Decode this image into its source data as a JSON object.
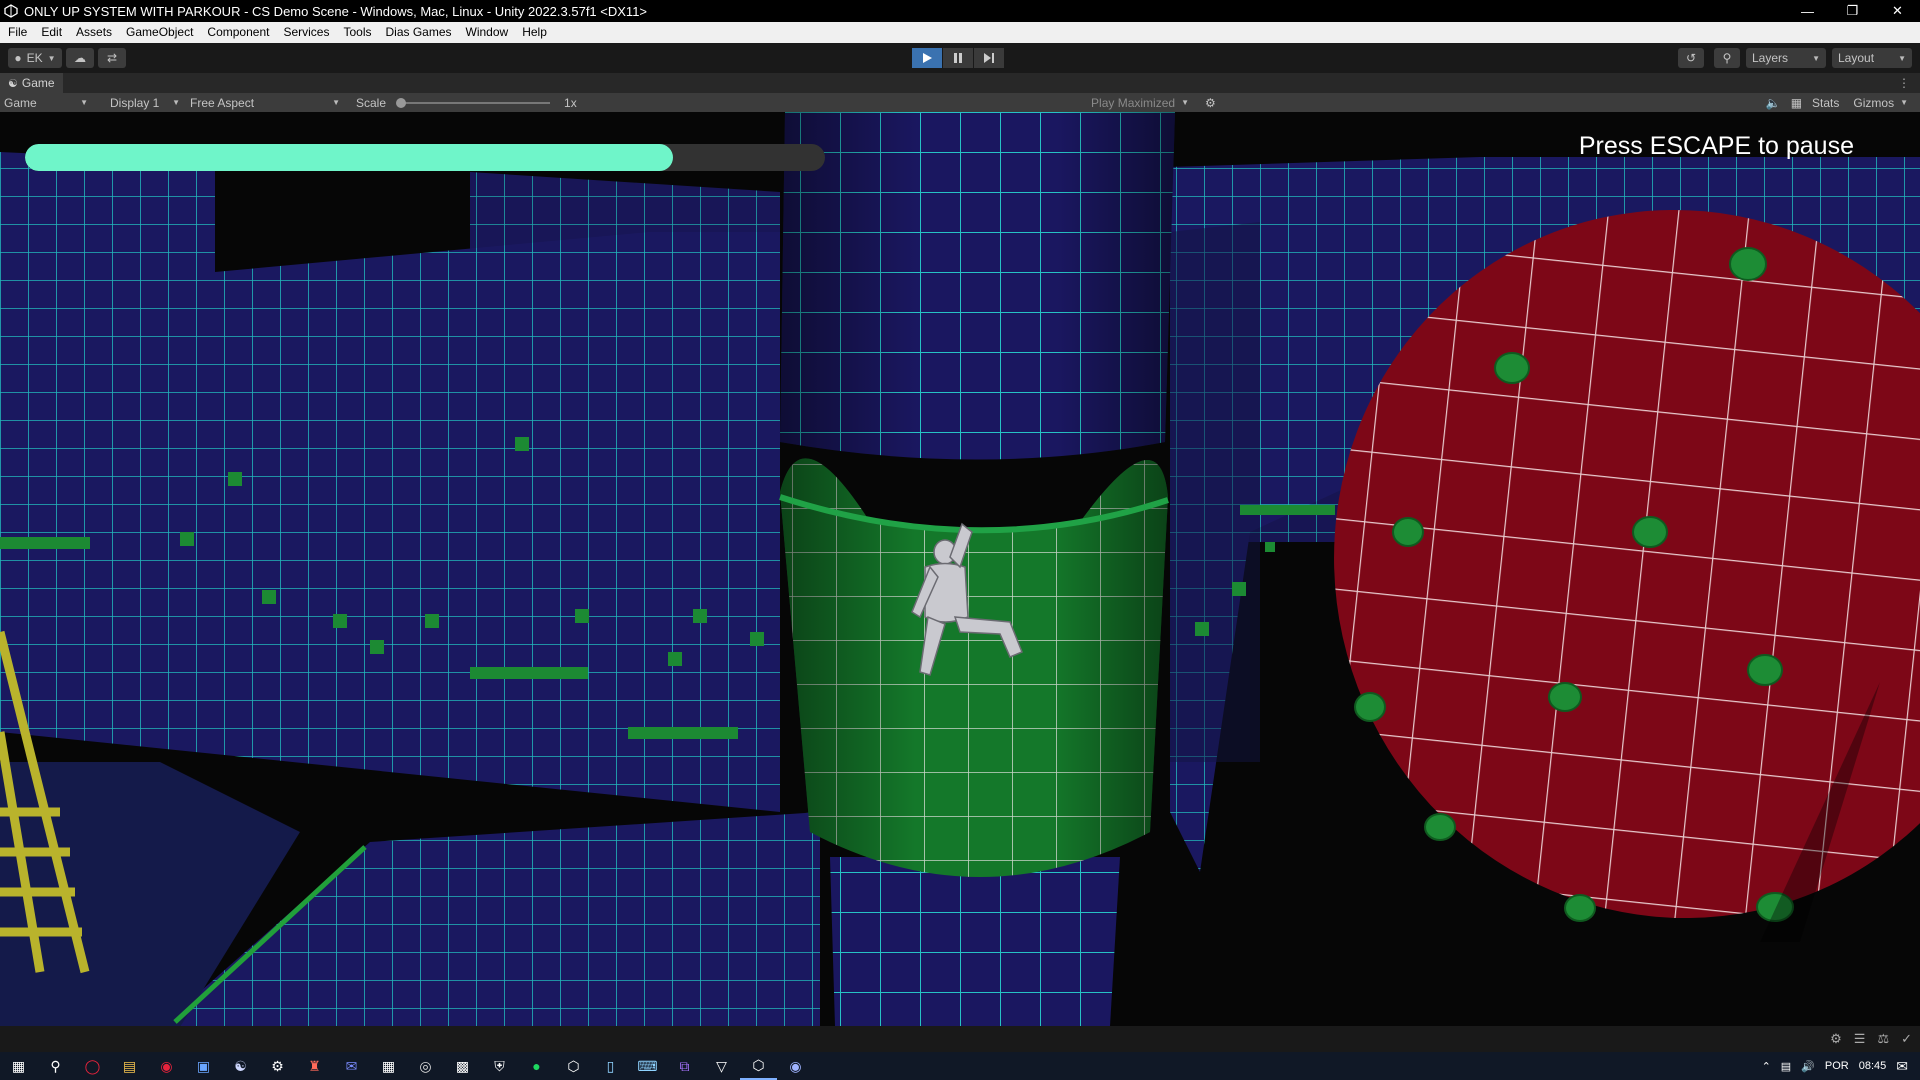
{
  "window": {
    "title": "ONLY UP SYSTEM WITH PARKOUR - CS Demo Scene - Windows, Mac, Linux - Unity 2022.3.57f1 <DX11>",
    "controls": [
      "minimize-icon",
      "restore-icon",
      "close-icon"
    ]
  },
  "menubar": {
    "items": [
      "File",
      "Edit",
      "Assets",
      "GameObject",
      "Component",
      "Services",
      "Tools",
      "Dias Games",
      "Window",
      "Help"
    ]
  },
  "toolbar": {
    "account_label": "EK",
    "layers_label": "Layers",
    "layout_label": "Layout",
    "play_active": true
  },
  "game_tab": {
    "label": "Game"
  },
  "game_controls": {
    "view_mode": "Game",
    "display": "Display 1",
    "aspect": "Free Aspect",
    "scale_label": "Scale",
    "scale_value": "1x",
    "play_mode": "Play Maximized",
    "stats_label": "Stats",
    "gizmos_label": "Gizmos"
  },
  "game_view": {
    "health_fraction": 0.81,
    "health_color": "#6ff5c9",
    "pause_hint": "Press ESCAPE to pause"
  },
  "taskbar": {
    "language": "POR",
    "time": "08:45"
  }
}
